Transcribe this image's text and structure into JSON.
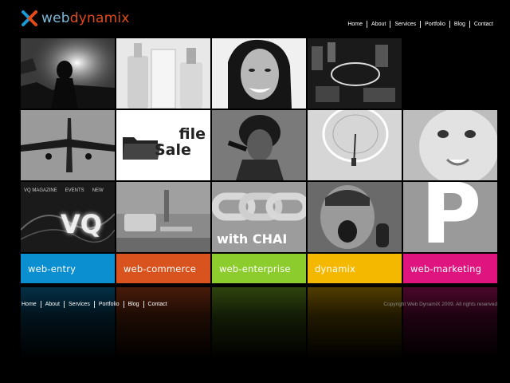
{
  "brand": {
    "web": "web",
    "dynamix": "dynamix"
  },
  "top_nav": [
    "Home",
    "About",
    "Services",
    "Portfolio",
    "Blog",
    "Contact"
  ],
  "tiles": {
    "file_sale": {
      "line1": "file",
      "line2": "Sale"
    },
    "vq": {
      "magazine": "VQ MAGAZINE",
      "events": "EVENTS",
      "new": "NEW",
      "logo": "VQ"
    },
    "chain": {
      "text": "with CHAI"
    },
    "p_logo": {
      "letter": "P"
    }
  },
  "categories": [
    {
      "label": "web-entry",
      "color": "#0b8fd0"
    },
    {
      "label": "web-commerce",
      "color": "#d9531e"
    },
    {
      "label": "web-enterprise",
      "color": "#8ccc2c"
    },
    {
      "label": "dynamix",
      "color": "#f4b800"
    },
    {
      "label": "web-marketing",
      "color": "#e0147f"
    }
  ],
  "footer_nav": [
    "Home",
    "About",
    "Services",
    "Portfolio",
    "Blog",
    "Contact"
  ],
  "copyright": "Copyright Web DynamiX 2009. All rights reserved"
}
